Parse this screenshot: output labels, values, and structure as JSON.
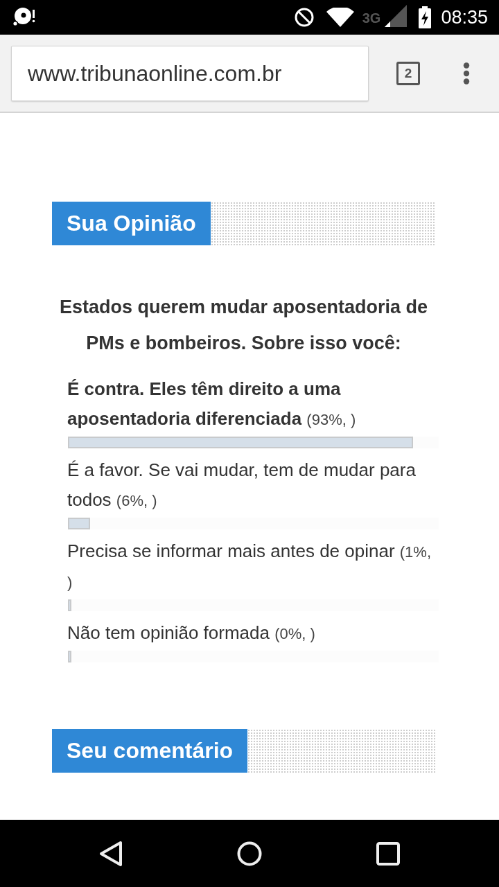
{
  "status_bar": {
    "network": "3G",
    "time": "08:35"
  },
  "browser": {
    "url": "www.tribunaonline.com.br",
    "tab_count": "2"
  },
  "poll": {
    "title": "Sua Opinião",
    "question": "Estados querem mudar aposentadoria de PMs e bombeiros. Sobre isso você:",
    "options": [
      {
        "label": "É contra. Eles têm direito a uma aposentadoria diferenciada",
        "result": "(93%, )",
        "leading": true,
        "level": 0.93
      },
      {
        "label": "É a favor. Se vai mudar, tem de mudar para todos",
        "result": "(6%, )",
        "leading": false,
        "level": 0.06
      },
      {
        "label": "Precisa se informar mais antes de opinar",
        "result": "(1%, )",
        "leading": false,
        "level": 0.01
      },
      {
        "label": "Não tem opinião formada",
        "result": "(0%, )",
        "leading": false,
        "level": 0
      }
    ]
  },
  "comments": {
    "title": "Seu comentário"
  }
}
